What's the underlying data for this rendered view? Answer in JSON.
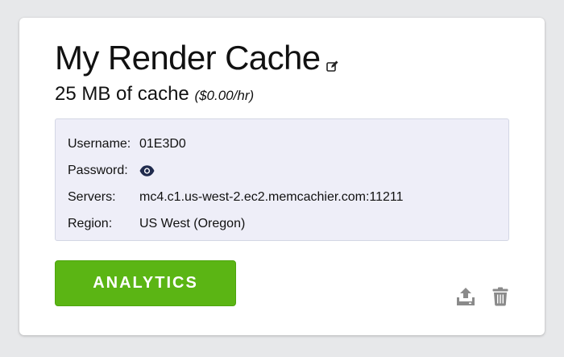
{
  "cache": {
    "name": "My Render Cache",
    "size_label": "25 MB of cache",
    "price_label": "($0.00/hr)"
  },
  "details": {
    "rows": [
      {
        "label": "Username:",
        "value": "01E3D0"
      },
      {
        "label": "Password:",
        "value_icon": "eye-icon"
      },
      {
        "label": "Servers:",
        "value": "mc4.c1.us-west-2.ec2.memcachier.com:11211"
      },
      {
        "label": "Region:",
        "value": "US West (Oregon)"
      }
    ]
  },
  "actions": {
    "analytics_label": "ANALYTICS",
    "icons": [
      "edit-icon",
      "export-icon",
      "trash-icon"
    ]
  },
  "colors": {
    "page_bg": "#e7e8ea",
    "card_bg": "#ffffff",
    "details_bg": "#eeeef8",
    "accent_green": "#5bb514",
    "icon_gray": "#8a8a8a",
    "eye_navy": "#1f2a4d"
  }
}
